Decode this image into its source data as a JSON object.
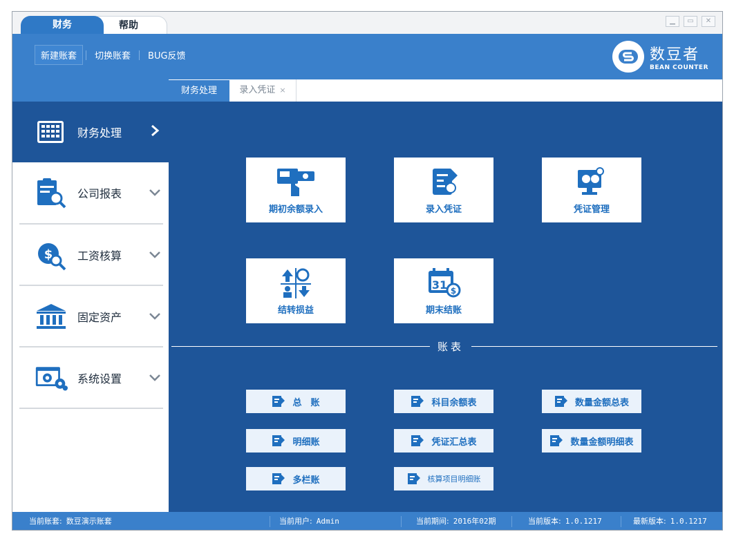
{
  "menu": {
    "tabs": [
      "财务",
      "帮助"
    ]
  },
  "window_controls": [
    "minimize",
    "restore",
    "close"
  ],
  "toolbar": {
    "new_account": "新建账套",
    "switch_account": "切换账套",
    "bug_feedback": "BUG反馈"
  },
  "logo": {
    "title": "数豆者",
    "subtitle": "BEAN COUNTER"
  },
  "tabs": {
    "active": "财务处理",
    "second": "录入凭证",
    "close_glyph": "×"
  },
  "sidebar": {
    "items": [
      {
        "label": "财务处理",
        "icon": "calculator-icon",
        "state": "active"
      },
      {
        "label": "公司报表",
        "icon": "report-clipboard-icon"
      },
      {
        "label": "工资核算",
        "icon": "salary-coin-icon"
      },
      {
        "label": "固定资产",
        "icon": "bank-building-icon"
      },
      {
        "label": "系统设置",
        "icon": "settings-gears-icon"
      }
    ]
  },
  "cards": [
    {
      "label": "期初余额录入",
      "icon": "pay-card-icon"
    },
    {
      "label": "录入凭证",
      "icon": "notebook-pen-icon"
    },
    {
      "label": "凭证管理",
      "icon": "monitor-money-icon"
    },
    {
      "label": "结转损益",
      "icon": "transfer-arrows-icon"
    },
    {
      "label": "期末结账",
      "icon": "calendar-31-icon"
    }
  ],
  "section": {
    "title": "账表"
  },
  "reports": [
    {
      "label": "总　账"
    },
    {
      "label": "科目余额表"
    },
    {
      "label": "数量金额总表"
    },
    {
      "label": "明细账"
    },
    {
      "label": "凭证汇总表"
    },
    {
      "label": "数量金额明细表"
    },
    {
      "label": "多栏账"
    },
    {
      "label": "核算项目明细账"
    }
  ],
  "status": {
    "account_label": "当前账套:",
    "account_value": "数豆演示账套",
    "user_label": "当前用户:",
    "user_value": "Admin",
    "period_label": "当前期间:",
    "period_value": "2016年02期",
    "version_label": "当前版本:",
    "version_value": "1.0.1217",
    "latest_label": "最新版本:",
    "latest_value": "1.0.1217"
  },
  "colors": {
    "header": "#3a80cb",
    "main": "#1e5599",
    "accent": "#1f6fbf",
    "card": "#ffffff"
  }
}
